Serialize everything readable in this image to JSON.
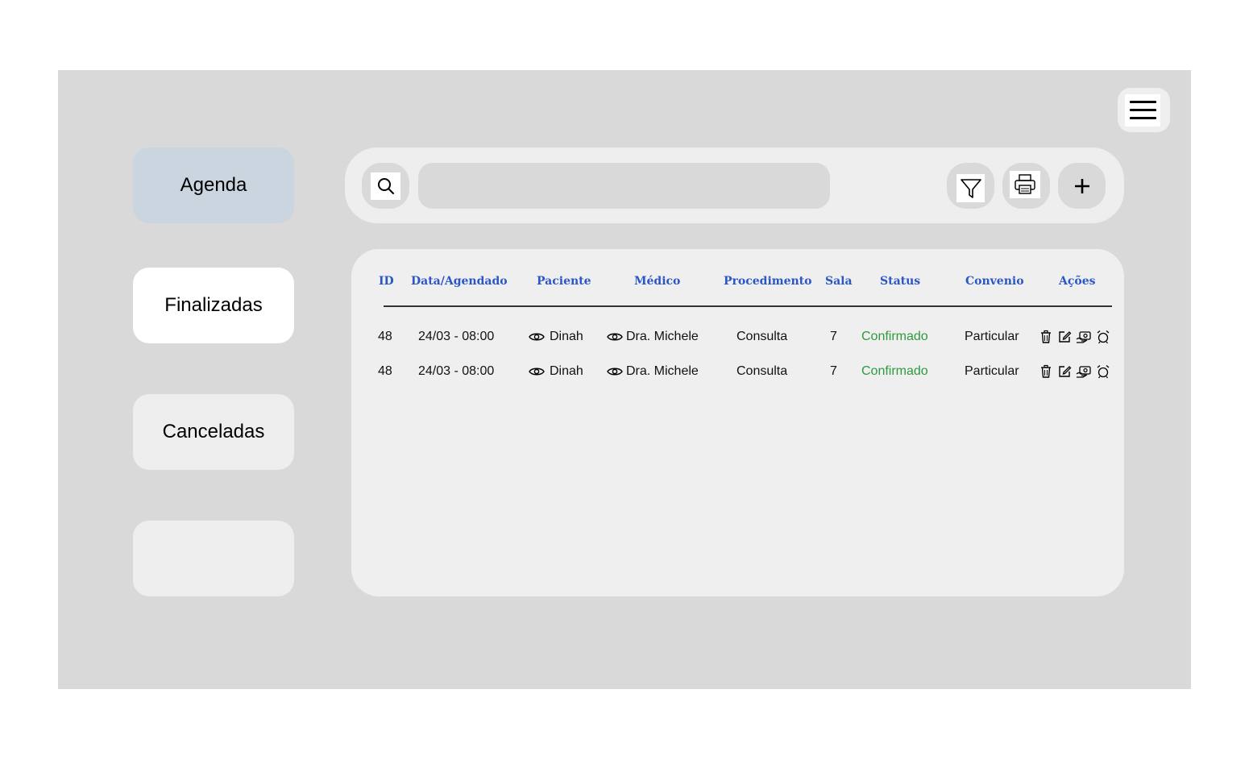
{
  "sidebar": {
    "items": [
      {
        "label": "Agenda",
        "active": true
      },
      {
        "label": "Finalizadas"
      },
      {
        "label": "Canceladas"
      },
      {
        "label": ""
      }
    ]
  },
  "toolbar": {
    "search_placeholder": "",
    "icons": [
      "search-icon",
      "filter-icon",
      "printer-icon",
      "plus-icon"
    ]
  },
  "table": {
    "columns": [
      "ID",
      "Data/Agendado",
      "Paciente",
      "Médico",
      "Procedimento",
      "Sala",
      "Status",
      "Convenio",
      "Ações"
    ],
    "rows": [
      {
        "id": "48",
        "date": "24/03 - 08:00",
        "patient": "Dinah",
        "doctor": "Dra. Michele",
        "procedure": "Consulta",
        "room": "7",
        "status": "Confirmado",
        "insurance": "Particular"
      },
      {
        "id": "48",
        "date": "24/03 - 08:00",
        "patient": "Dinah",
        "doctor": "Dra. Michele",
        "procedure": "Consulta",
        "room": "7",
        "status": "Confirmado",
        "insurance": "Particular"
      }
    ],
    "action_icons": [
      "trash-icon",
      "edit-icon",
      "payment-icon",
      "alarm-icon"
    ]
  },
  "colors": {
    "header_text": "#2a56c6",
    "status_confirmed": "#2e9a3e",
    "active_tab": "#cbd5df",
    "frame_bg": "#d9d9d9"
  }
}
